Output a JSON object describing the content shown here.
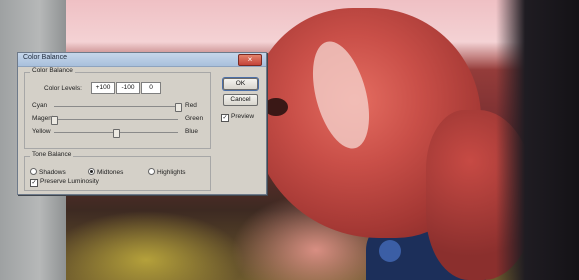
{
  "dialog": {
    "title": "Color Balance",
    "close_label": "×",
    "color_balance": {
      "group_label": "Color Balance",
      "levels_label": "Color Levels:",
      "levels": [
        "+100",
        "-100",
        "0"
      ],
      "sliders": [
        {
          "left": "Cyan",
          "right": "Red",
          "value": 100
        },
        {
          "left": "Magenta",
          "right": "Green",
          "value": -100
        },
        {
          "left": "Yellow",
          "right": "Blue",
          "value": 0
        }
      ]
    },
    "tone_balance": {
      "group_label": "Tone Balance",
      "options": [
        "Shadows",
        "Midtones",
        "Highlights"
      ],
      "selected": "Midtones",
      "preserve_label": "Preserve Luminosity",
      "preserve_checked": true
    },
    "buttons": {
      "ok": "OK",
      "cancel": "Cancel"
    },
    "preview": {
      "label": "Preview",
      "checked": true
    }
  },
  "colors": {
    "titlebar": "#a9c0dc",
    "dialog_bg": "#d4d0c8",
    "close": "#c4443a"
  }
}
